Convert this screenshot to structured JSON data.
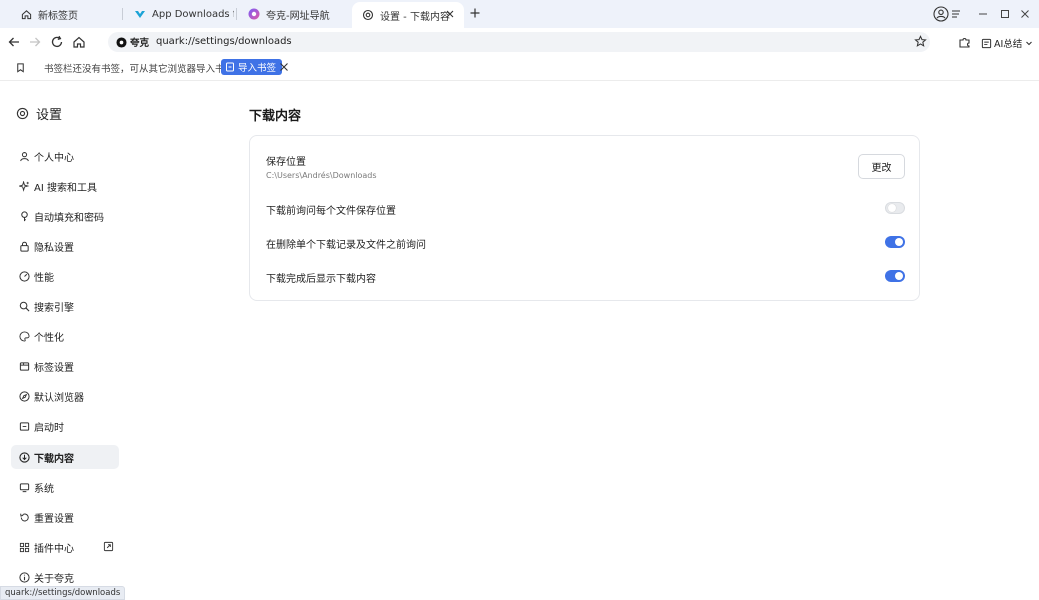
{
  "tabs": [
    {
      "title": "新标签页",
      "icon": "home-icon"
    },
    {
      "title": "App Downloads for Wi",
      "icon": "uptodown-logo-icon"
    },
    {
      "title": "夸克-网址导航",
      "icon": "quark-logo-icon"
    },
    {
      "title": "设置 - 下载内容",
      "icon": "gear-icon",
      "active": true
    }
  ],
  "toolbar": {
    "site_label": "夸克",
    "url": "quark://settings/downloads",
    "ai_label": "AI总结"
  },
  "bookmarks_bar": {
    "empty_text": "书签栏还没有书签，可从其它浏览器导入书签",
    "import_label": "导入书签"
  },
  "sidebar": {
    "title": "设置",
    "items": [
      {
        "label": "个人中心",
        "icon": "person-icon"
      },
      {
        "label": "AI 搜索和工具",
        "icon": "sparkle-icon"
      },
      {
        "label": "自动填充和密码",
        "icon": "key-icon"
      },
      {
        "label": "隐私设置",
        "icon": "lock-icon"
      },
      {
        "label": "性能",
        "icon": "gauge-icon"
      },
      {
        "label": "搜索引擎",
        "icon": "search-icon"
      },
      {
        "label": "个性化",
        "icon": "palette-icon"
      },
      {
        "label": "标签设置",
        "icon": "tab-icon"
      },
      {
        "label": "默认浏览器",
        "icon": "compass-icon"
      },
      {
        "label": "启动时",
        "icon": "startup-icon"
      },
      {
        "label": "下载内容",
        "icon": "download-icon",
        "active": true
      },
      {
        "label": "系统",
        "icon": "monitor-icon"
      },
      {
        "label": "重置设置",
        "icon": "reset-icon"
      },
      {
        "label": "插件中心",
        "icon": "extensions-grid-icon"
      },
      {
        "label": "关于夸克",
        "icon": "info-icon"
      }
    ]
  },
  "main": {
    "title": "下载内容",
    "location_label": "保存位置",
    "location_path": "C:\\Users\\Andrés\\Downloads",
    "change_button": "更改",
    "settings": [
      {
        "label": "下载前询问每个文件保存位置",
        "enabled": false
      },
      {
        "label": "在删除单个下载记录及文件之前询问",
        "enabled": true
      },
      {
        "label": "下载完成后显示下载内容",
        "enabled": true
      }
    ]
  },
  "status_url": "quark://settings/downloads",
  "colors": {
    "accent": "#3f72e6",
    "tabstrip": "#eef2fa"
  }
}
